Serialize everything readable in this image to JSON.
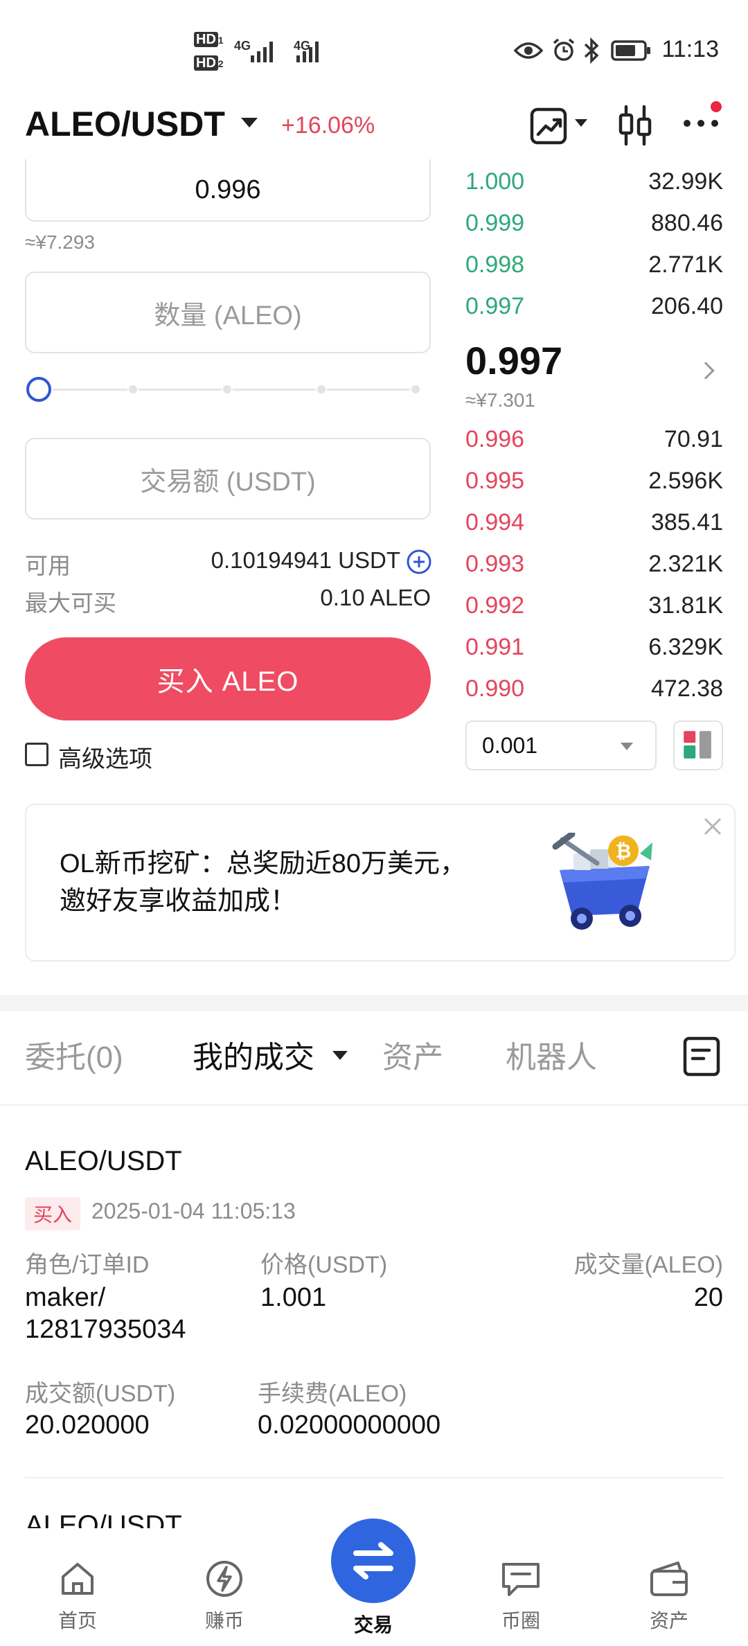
{
  "status_bar": {
    "hd1": "HD",
    "hd1_sub": "1",
    "hd2": "HD",
    "hd2_sub": "2",
    "net1": "4G",
    "net2": "4G",
    "time": "11:13"
  },
  "header": {
    "pair": "ALEO/USDT",
    "change": "+16.06%",
    "icons": [
      "chart-trend-icon",
      "candlestick-icon",
      "more-icon"
    ],
    "accent_color": "#2f55d4",
    "up_color": "#2ea87a",
    "down_color": "#e2455c"
  },
  "order_form": {
    "price_value": "0.996",
    "price_cny": "≈¥7.293",
    "amount_placeholder": "数量 (ALEO)",
    "total_placeholder": "交易额 (USDT)",
    "slider_level_percent": 0,
    "available_label": "可用",
    "available_value": "0.10194941 USDT",
    "max_buy_label": "最大可买",
    "max_buy_value": "0.10 ALEO",
    "buy_button": "买入 ALEO",
    "advanced_label": "高级选项"
  },
  "order_book": {
    "asks": [
      {
        "price": "1.000",
        "qty": "32.99K"
      },
      {
        "price": "0.999",
        "qty": "880.46"
      },
      {
        "price": "0.998",
        "qty": "2.771K"
      },
      {
        "price": "0.997",
        "qty": "206.40"
      }
    ],
    "last_price": "0.997",
    "last_price_cny": "≈¥7.301",
    "bids": [
      {
        "price": "0.996",
        "qty": "70.91"
      },
      {
        "price": "0.995",
        "qty": "2.596K"
      },
      {
        "price": "0.994",
        "qty": "385.41"
      },
      {
        "price": "0.993",
        "qty": "2.321K"
      },
      {
        "price": "0.992",
        "qty": "31.81K"
      },
      {
        "price": "0.991",
        "qty": "6.329K"
      },
      {
        "price": "0.990",
        "qty": "472.38"
      }
    ],
    "depth_value": "0.001"
  },
  "banner": {
    "text": "OL新币挖矿：总奖励近80万美元，邀好友享收益加成！"
  },
  "tabs": [
    "委托(0)",
    "我的成交",
    "资产",
    "机器人"
  ],
  "trade_record": {
    "pair": "ALEO/USDT",
    "side": "买入",
    "time": "2025-01-04 11:05:13",
    "role_label": "角色/订单ID",
    "role_value_line1": "maker/",
    "role_value_line2": "12817935034",
    "price_label": "价格(USDT)",
    "price_value": "1.001",
    "volume_label": "成交量(ALEO)",
    "volume_value": "20",
    "amount_label": "成交额(USDT)",
    "amount_value": "20.020000",
    "fee_label": "手续费(ALEO)",
    "fee_value": "0.02000000000",
    "next_pair": "ALEO/USDT"
  },
  "bottom_nav": {
    "items": [
      "首页",
      "赚币",
      "交易",
      "币圈",
      "资产"
    ],
    "active": "交易"
  }
}
